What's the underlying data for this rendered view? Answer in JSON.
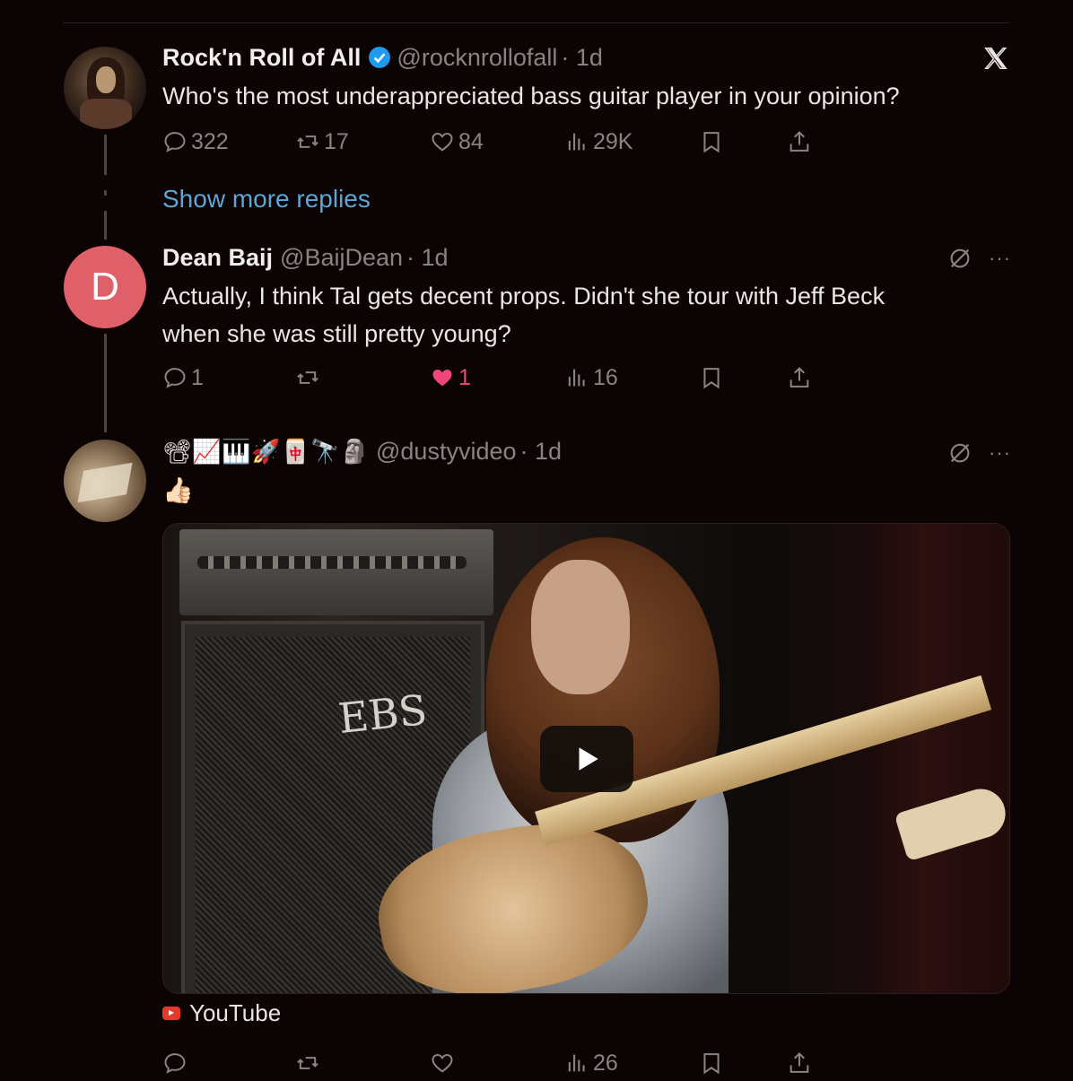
{
  "brand": {
    "logo": "x-logo-icon"
  },
  "tweets": [
    {
      "name": "Rock'n Roll of All",
      "handle": "@rocknrollofall",
      "time": "· 1d",
      "text": "Who's the most underappreciated bass guitar player in your opinion?",
      "replies": "322",
      "retweets": "17",
      "likes": "84",
      "views": "29K"
    },
    {
      "avatar_letter": "D",
      "name": "Dean Baij",
      "handle": "@BaijDean",
      "time": "· 1d",
      "text_line1": "Actually, I think Tal gets decent props. Didn't she tour with Jeff Beck",
      "text_line2": "when she was still pretty young?",
      "replies": "1",
      "retweets": "",
      "likes": "1",
      "views": "16"
    },
    {
      "name_emojis": [
        "📽",
        "📈",
        "🎹",
        "🚀",
        "🀄",
        "🔭",
        "🗿"
      ],
      "handle": "@dustyvideo",
      "time": "· 1d",
      "text": "👍🏻",
      "video_brand_text": "EBS",
      "link_source": "YouTube",
      "replies": "",
      "retweets": "",
      "likes": "",
      "views": "26"
    }
  ],
  "show_more_replies": "Show more replies",
  "colors": {
    "accent": "#5ea5d4",
    "like": "#f0467c",
    "avatar_d": "#e0606a",
    "background": "#0c0304"
  }
}
